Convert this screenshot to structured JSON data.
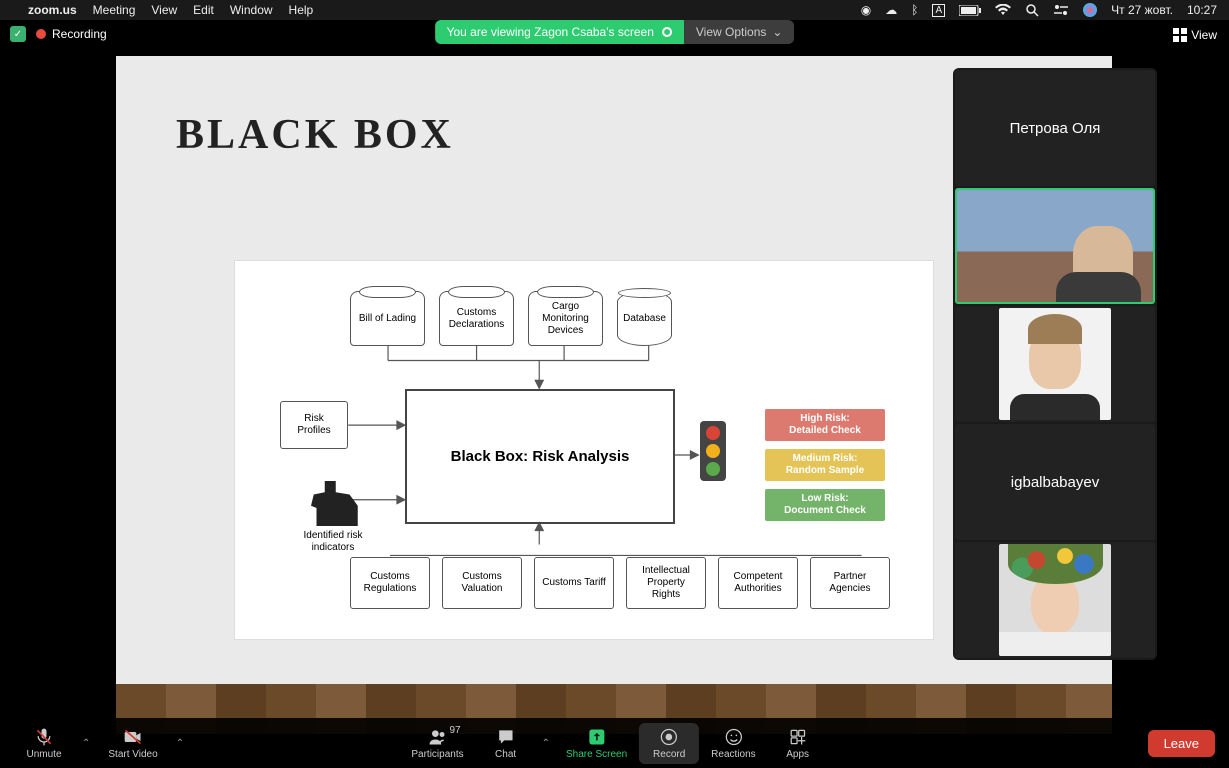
{
  "menubar": {
    "app": "zoom.us",
    "items": [
      "Meeting",
      "View",
      "Edit",
      "Window",
      "Help"
    ],
    "right": {
      "date": "Чт 27 жовт.",
      "time": "10:27"
    }
  },
  "zoomtop": {
    "recording": "Recording",
    "screenshare": "You are viewing Zagon Csaba's screen",
    "view_options": "View Options",
    "view_btn": "View"
  },
  "slide": {
    "title": "BLACK BOX",
    "sources": {
      "s1": "Bill of Lading",
      "s2": "Customs\nDeclarations",
      "s3": "Cargo\nMonitoring\nDevices",
      "s4": "Database"
    },
    "risk_profiles": "Risk\nProfiles",
    "officer": "Identified risk\nindicators",
    "center": "Black Box: Risk Analysis",
    "risk_high": "High Risk:\nDetailed Check",
    "risk_med": "Medium Risk:\nRandom Sample",
    "risk_low": "Low Risk:\nDocument Check",
    "refs": {
      "r1": "Customs\nRegulations",
      "r2": "Customs\nValuation",
      "r3": "Customs Tariff",
      "r4": "Intellectual\nProperty\nRights",
      "r5": "Competent\nAuthorities",
      "r6": "Partner\nAgencies"
    }
  },
  "participants": {
    "p1": "Петрова Оля",
    "p4": "igbalbabayev"
  },
  "toolbar": {
    "unmute": "Unmute",
    "start_video": "Start Video",
    "participants": "Participants",
    "participants_count": "97",
    "chat": "Chat",
    "share": "Share Screen",
    "record": "Record",
    "reactions": "Reactions",
    "apps": "Apps",
    "leave": "Leave"
  }
}
